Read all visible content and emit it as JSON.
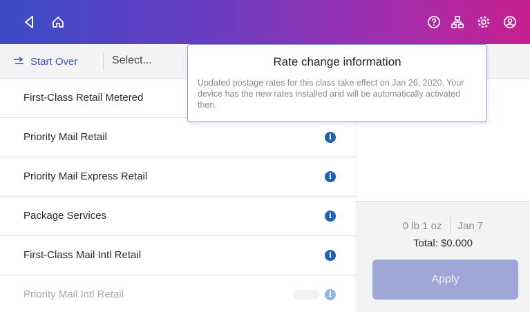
{
  "header": {
    "icons": [
      "back-icon",
      "home-icon",
      "help-icon",
      "network-icon",
      "settings-icon",
      "account-icon"
    ]
  },
  "toolbar": {
    "start_over_label": "Start Over",
    "select_label": "Select..."
  },
  "rate_list": {
    "items": [
      {
        "label": "First-Class Retail Metered"
      },
      {
        "label": "Priority Mail Retail"
      },
      {
        "label": "Priority Mail Express Retail"
      },
      {
        "label": "Package Services"
      },
      {
        "label": "First-Class Mail Intl Retail"
      },
      {
        "label": "Priority Mail Intl Retail"
      }
    ]
  },
  "summary": {
    "weight": "0 lb 1 oz",
    "date": "Jan 7",
    "total": "Total: $0.000",
    "apply_label": "Apply"
  },
  "tooltip": {
    "title": "Rate change information",
    "body": "Updated postage rates for this class take effect on Jan 26, 2020. Your device has the new rates installed and will be automatically activated then."
  },
  "colors": {
    "header_gradient_start": "#3b4cc8",
    "header_gradient_end": "#c8208f",
    "link_blue": "#3a4fbf",
    "info_blue": "#1f5fb4",
    "apply_disabled": "#9fa6d8"
  }
}
